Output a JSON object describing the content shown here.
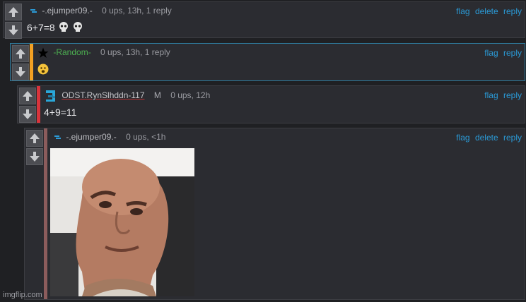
{
  "comments": [
    {
      "username": "-.ejumper09.-",
      "meta": "0 ups, 13h, 1 reply",
      "text": "6+7=8",
      "actions": [
        "flag",
        "delete",
        "reply"
      ],
      "icon": "blue-dash-icon"
    },
    {
      "username": "-Random-",
      "meta": "0 ups, 13h, 1 reply",
      "text": "",
      "actions": [
        "flag",
        "reply"
      ],
      "icon": "black-star-icon",
      "stripe_color": "#f2a023"
    },
    {
      "username": "ODST.RynSlhddn-117",
      "mod_badge": "M",
      "meta": "0 ups, 12h",
      "text": "4+9=11",
      "actions": [
        "flag",
        "reply"
      ],
      "icon": "pixel-helmet-icon",
      "stripe_color": "#d8343c"
    },
    {
      "username": "-.ejumper09.-",
      "meta": "0 ups, <1h",
      "text": "",
      "actions": [
        "flag",
        "delete",
        "reply"
      ],
      "icon": "blue-dash-icon",
      "stripe_color": "#8b5c5c",
      "image": "the-rock-eyebrow-raise-meme"
    }
  ],
  "watermark": "imgflip.com",
  "colors": {
    "background": "#1f2023",
    "card": "#2b2c31",
    "link": "#2b9bd8",
    "green_user": "#4caf50"
  }
}
